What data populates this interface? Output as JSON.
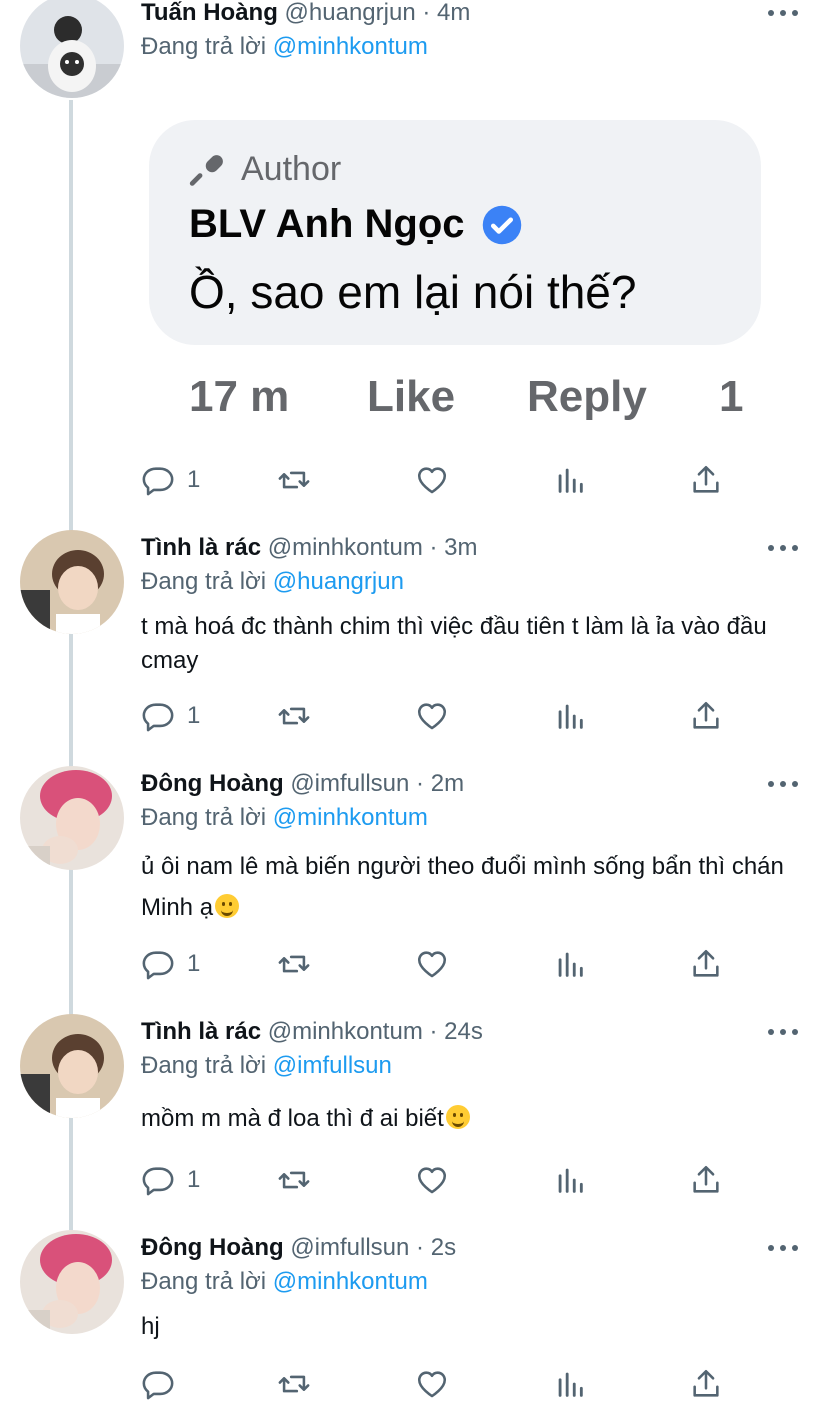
{
  "tweets": [
    {
      "name": "Tuấn Hoàng",
      "handle": "@huangrjun",
      "dot": "·",
      "time": "4m",
      "reply_label": "Đang trả lời",
      "reply_to": "@minhkontum",
      "text": "",
      "reply_count": "1",
      "embedded": {
        "author_label": "Author",
        "name": "BLV Anh Ngọc",
        "message": "Ồ, sao em lại nói thế?",
        "time": "17 m",
        "like": "Like",
        "reply": "Reply",
        "extra": "1"
      }
    },
    {
      "name": "Tình là rác",
      "handle": "@minhkontum",
      "dot": "·",
      "time": "3m",
      "reply_label": "Đang trả lời",
      "reply_to": "@huangrjun",
      "text": "t mà hoá đc thành chim thì việc đầu tiên t làm là ỉa vào đầu cmay",
      "reply_count": "1"
    },
    {
      "name": "Đông Hoàng",
      "handle": "@imfullsun",
      "dot": "·",
      "time": "2m",
      "reply_label": "Đang trả lời",
      "reply_to": "@minhkontum",
      "text": "ủ ôi nam lê mà biến người theo đuổi mình sống bẩn thì chán Minh ạ",
      "emoji": "smirk-face-emoji",
      "reply_count": "1"
    },
    {
      "name": "Tình là rác",
      "handle": "@minhkontum",
      "dot": "·",
      "time": "24s",
      "reply_label": "Đang trả lời",
      "reply_to": "@imfullsun",
      "text": "mồm m mà đ loa thì đ ai biết",
      "emoji": "grinning-face-emoji",
      "reply_count": "1"
    },
    {
      "name": "Đông Hoàng",
      "handle": "@imfullsun",
      "dot": "·",
      "time": "2s",
      "reply_label": "Đang trả lời",
      "reply_to": "@minhkontum",
      "text": "hj",
      "reply_count": ""
    }
  ],
  "icons": {
    "reply": "speech-bubble-icon",
    "retweet": "retweet-icon",
    "like": "heart-icon",
    "views": "bar-chart-icon",
    "share": "share-icon",
    "more": "more-dots-icon"
  },
  "colors": {
    "link": "#1d9bf0",
    "muted": "#536471",
    "thread_line": "#cfd9de"
  }
}
